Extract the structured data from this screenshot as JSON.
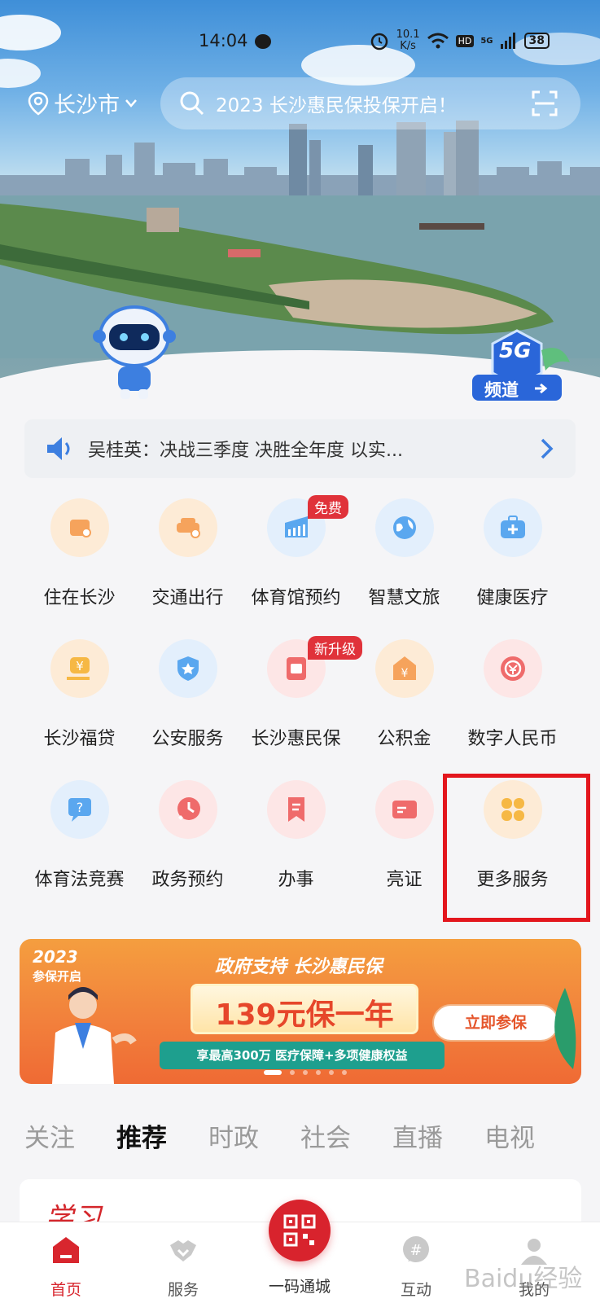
{
  "status_bar": {
    "time": "14:04",
    "net_speed_top": "10.1",
    "net_speed_unit": "K/s",
    "hd": "HD",
    "network": "5G",
    "battery": "38"
  },
  "header": {
    "city": "长沙市",
    "search_placeholder": "2023 长沙惠民保投保开启！"
  },
  "hero": {
    "channel_badge_top": "5G",
    "channel_badge_label": "频道"
  },
  "notice": {
    "text": "吴桂英：决战三季度 决胜全年度 以实..."
  },
  "services": [
    {
      "label": "住在长沙",
      "icon": "house-wallet-icon",
      "color": "#f6a35c"
    },
    {
      "label": "交通出行",
      "icon": "car-icon",
      "color": "#f6a35c"
    },
    {
      "label": "体育馆预约",
      "icon": "stadium-icon",
      "color": "#5aa7ef",
      "badge": "免费"
    },
    {
      "label": "智慧文旅",
      "icon": "globe-icon",
      "color": "#5aa7ef"
    },
    {
      "label": "健康医疗",
      "icon": "medical-kit-icon",
      "color": "#5aa7ef"
    },
    {
      "label": "长沙福贷",
      "icon": "yuan-hand-icon",
      "color": "#f6b844"
    },
    {
      "label": "公安服务",
      "icon": "police-shield-icon",
      "color": "#5aa7ef"
    },
    {
      "label": "长沙惠民保",
      "icon": "insurance-doc-icon",
      "color": "#ef6b6b",
      "badge": "新升级"
    },
    {
      "label": "公积金",
      "icon": "yuan-house-icon",
      "color": "#f6a35c"
    },
    {
      "label": "数字人民币",
      "icon": "digital-yuan-icon",
      "color": "#ef6b6b"
    },
    {
      "label": "体育法竞赛",
      "icon": "quiz-icon",
      "color": "#5aa7ef"
    },
    {
      "label": "政务预约",
      "icon": "clock-icon",
      "color": "#ef6b6b"
    },
    {
      "label": "办事",
      "icon": "bookmark-icon",
      "color": "#ef6b6b"
    },
    {
      "label": "亮证",
      "icon": "id-card-icon",
      "color": "#ef6b6b"
    },
    {
      "label": "更多服务",
      "icon": "four-petal-grid-icon",
      "color": "#f6b844"
    }
  ],
  "banner": {
    "year": "2023",
    "year_sub": "参保开启",
    "slogan": "政府支持 长沙惠民保",
    "price": "139元保一年",
    "subtitle": "享最高300万 医疗保障+多项健康权益",
    "cta": "立即参保"
  },
  "feed_tabs": [
    {
      "label": "关注",
      "active": false
    },
    {
      "label": "推荐",
      "active": true
    },
    {
      "label": "时政",
      "active": false
    },
    {
      "label": "社会",
      "active": false
    },
    {
      "label": "直播",
      "active": false
    },
    {
      "label": "电视",
      "active": false
    }
  ],
  "card_logo": "学习",
  "bottom_nav": [
    {
      "label": "首页",
      "icon": "home-icon",
      "active": true
    },
    {
      "label": "服务",
      "icon": "handshake-icon",
      "active": false
    },
    {
      "label": "一码通城",
      "icon": "qr-code-icon",
      "active": false
    },
    {
      "label": "互动",
      "icon": "hashtag-chat-icon",
      "active": false
    },
    {
      "label": "我的",
      "icon": "profile-icon",
      "active": false
    }
  ],
  "watermark": "Baidu经验"
}
